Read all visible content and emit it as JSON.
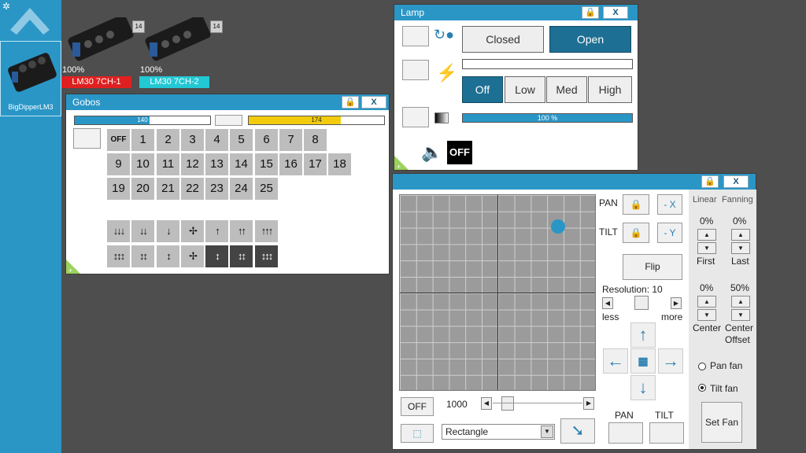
{
  "sidebar": {
    "fixture_label": "BigDipperLM3"
  },
  "fixtures": [
    {
      "count": "14",
      "percent": "100%",
      "name": "LM30 7CH-1",
      "color": "#e02020"
    },
    {
      "count": "14",
      "percent": "100%",
      "name": "LM30 7CH-2",
      "color": "#22c8d4"
    }
  ],
  "gobos": {
    "title": "Gobos",
    "bar1_value": "140",
    "bar1_fraction": 0.55,
    "bar2_value": "174",
    "bar2_fraction": 0.68,
    "buttons": [
      "OFF",
      "1",
      "2",
      "3",
      "4",
      "5",
      "6",
      "7",
      "8",
      "9",
      "10",
      "11",
      "12",
      "13",
      "14",
      "15",
      "16",
      "17",
      "18",
      "19",
      "20",
      "21",
      "22",
      "23",
      "24",
      "25"
    ],
    "arrows_row1": [
      "↓↓↓",
      "↓↓",
      "↓",
      "✢",
      "↑",
      "↑↑",
      "↑↑↑"
    ],
    "arrows_row2": [
      "↕↕↕",
      "↕↕",
      "↕",
      "✢",
      "↕",
      "↕↕",
      "↕↕↕"
    ],
    "close_label": "X"
  },
  "lamp": {
    "title": "Lamp",
    "shutter": [
      "Closed",
      "Open"
    ],
    "power": [
      "Off",
      "Low",
      "Med",
      "High"
    ],
    "dimmer_value": "100 %",
    "dimmer_fraction": 1.0,
    "sound_label": "OFF",
    "close_label": "X"
  },
  "pantilt": {
    "pan_label": "PAN",
    "tilt_label": "TILT",
    "minus_x": "- X",
    "minus_y": "- Y",
    "flip": "Flip",
    "resolution": "Resolution: 10",
    "less": "less",
    "more": "more",
    "off": "OFF",
    "speed": "1000",
    "shape": "Rectangle",
    "pan_btn": "PAN",
    "tilt_btn": "TILT",
    "close_label": "X",
    "linear": "Linear",
    "fanning": "Fanning",
    "first_val": "0%",
    "first": "First",
    "last_val": "0%",
    "last": "Last",
    "center_val": "0%",
    "center": "Center",
    "offset_val": "50%",
    "offset": "Center Offset",
    "pan_fan": "Pan fan",
    "tilt_fan": "Tilt fan",
    "set_fan": "Set Fan",
    "point_pan_fraction": 0.81,
    "point_tilt_fraction": 0.16
  }
}
